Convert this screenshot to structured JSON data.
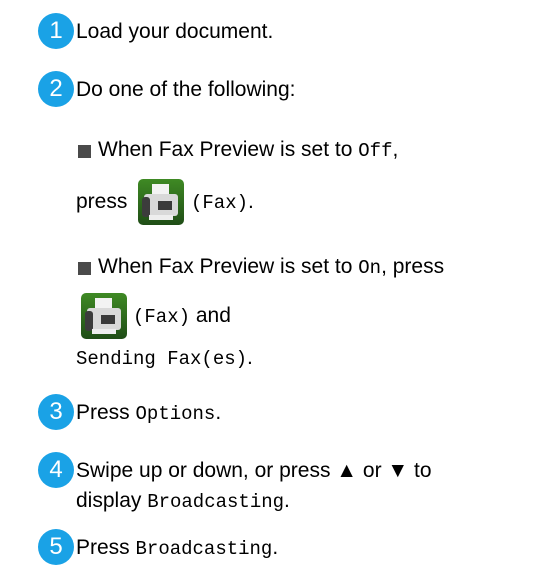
{
  "steps": [
    {
      "number": "1",
      "text": "Load your document."
    },
    {
      "number": "2",
      "text": "Do one of the following:"
    },
    {
      "number": "3",
      "text_before": "Press ",
      "code": "Options",
      "text_after": "."
    },
    {
      "number": "4",
      "line1": "Swipe up or down, or press ▲ or ▼ to",
      "line2_before": "display ",
      "line2_code": "Broadcasting",
      "line2_after": "."
    },
    {
      "number": "5",
      "text_before": "Press ",
      "code": "Broadcasting",
      "text_after": "."
    }
  ],
  "bullets": [
    {
      "line1_before": "When Fax Preview is set to ",
      "line1_code": "Off",
      "line1_after": ",",
      "line2_before": "press ",
      "icon": "fax-icon",
      "line2_code": "(Fax)",
      "line2_after": "."
    },
    {
      "line1_before": "When Fax Preview is set to ",
      "line1_code": "On",
      "line1_after": ", press",
      "icon": "fax-icon",
      "line2_code": "(Fax)",
      "line2_after": " and",
      "line3_code": "Sending Fax(es)",
      "line3_after": "."
    }
  ],
  "colors": {
    "step_circle": "#1aa2e6",
    "bullet_square": "#4a4a4a",
    "fax_icon_bg": "#2e6b1f"
  }
}
